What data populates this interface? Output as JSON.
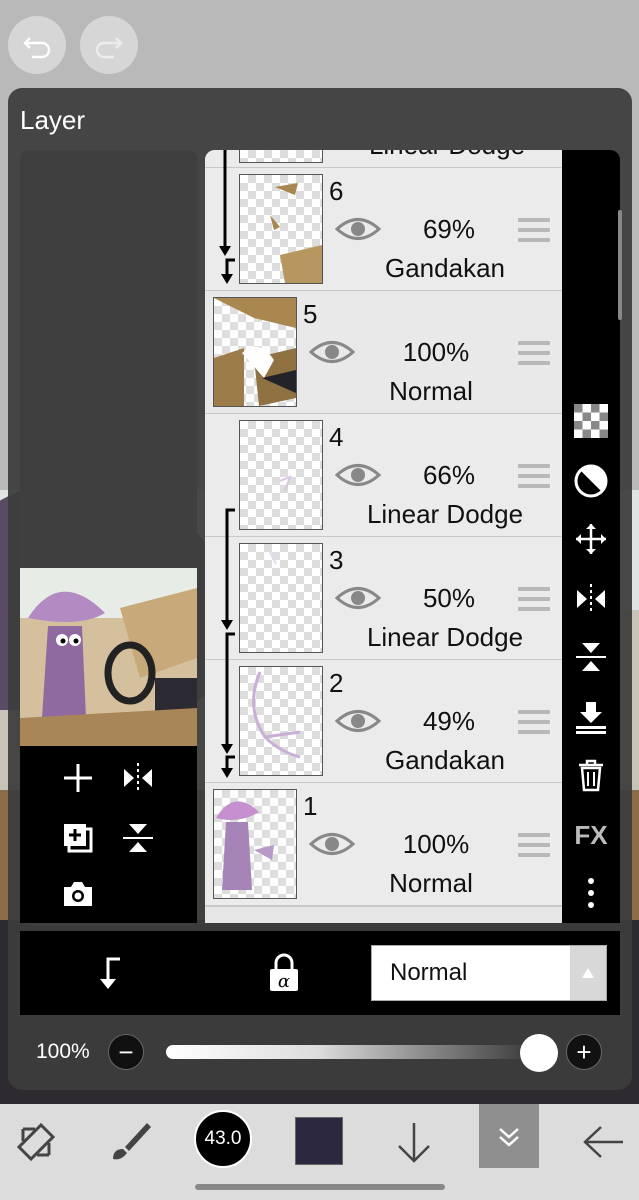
{
  "colors": {
    "panel": "#3c3c3c",
    "list_bg": "#ebebeb",
    "accent": "#ffffff",
    "color_swatch": "#2b2840"
  },
  "toolbar_top": {
    "undo_icon": "undo-icon",
    "redo_icon": "redo-icon"
  },
  "panel": {
    "title": "Layer"
  },
  "layers": [
    {
      "num": "",
      "opacity": "",
      "blend": "Linear Dodge"
    },
    {
      "num": "6",
      "opacity": "69%",
      "blend": "Gandakan"
    },
    {
      "num": "5",
      "opacity": "100%",
      "blend": "Normal"
    },
    {
      "num": "4",
      "opacity": "66%",
      "blend": "Linear Dodge"
    },
    {
      "num": "3",
      "opacity": "50%",
      "blend": "Linear Dodge"
    },
    {
      "num": "2",
      "opacity": "49%",
      "blend": "Gandakan"
    },
    {
      "num": "1",
      "opacity": "100%",
      "blend": "Normal"
    }
  ],
  "tools": {
    "fx_label": "FX"
  },
  "blend_mode": {
    "selected": "Normal"
  },
  "opacity": {
    "label": "100%",
    "value": 1.0
  },
  "bottom": {
    "brush_size": "43.0"
  }
}
